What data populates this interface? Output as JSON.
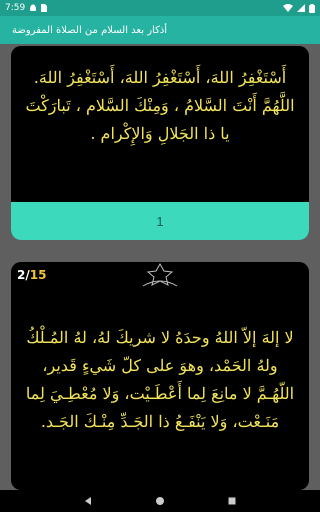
{
  "status_bar": {
    "time": "7:59"
  },
  "app_bar": {
    "title": "أذكار بعد السلام من الصلاة المفروضة"
  },
  "cards": [
    {
      "text": "أَسْتَغْفِرُ اللهَ، أَسْتَغْفِرُ اللهَ، أَسْتَغْفِرُ اللهَ. اللَّهُمَّ أَنْتَ السَّلامُ ، وَمِنْكَ السَّلام ، تَبارَكْتَ يا ذا الجَلالِ وَالإِكْرام .",
      "counter": "1"
    },
    {
      "page_current": "2",
      "page_separator": "/",
      "page_total": "15",
      "text": "لا إلهَ إلاّ اللهُ وحدَهُ لا شريكَ لهُ، لهُ المُـلْكُ ولهُ الحَمْد، وهوَ على كلّ شَيءٍ قَدير، اللّهُـمَّ لا مانِعَ لِما أَعْطَـيْت، وَلا مُعْطِـيَ لِما مَنَـعْت، وَلا يَنْفَـعُ ذا الجَـدِّ مِنْـكَ الجَـد."
    }
  ],
  "colors": {
    "status_bar": "#1f9e8e",
    "app_bar": "#26b3a1",
    "counter_button": "#3dd9bd",
    "dhikr_text": "#f2e35a",
    "page_total": "#f2c23b"
  }
}
